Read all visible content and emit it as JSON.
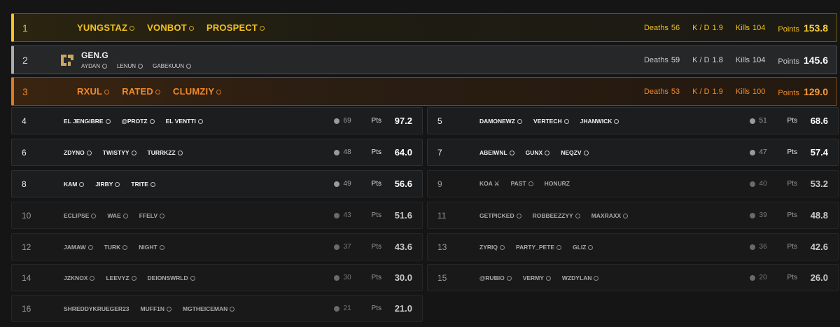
{
  "colors": {
    "gold": "#f5c518",
    "silver": "#a9abae",
    "bronze": "#e07a1a",
    "background": "#151515"
  },
  "top3": [
    {
      "rank": "1",
      "players": [
        "YUNGSTAZ",
        "VONBOT",
        "PROSPECT"
      ],
      "deaths_label": "Deaths",
      "deaths": "56",
      "kd_label": "K / D",
      "kd": "1.9",
      "kills_label": "Kills",
      "kills": "104",
      "points_label": "Points",
      "points": "153.8"
    },
    {
      "rank": "2",
      "team": "GEN.G",
      "logo": "geng-logo-icon",
      "players": [
        "AYDAN",
        "LENUN",
        "GABEKUUN"
      ],
      "deaths_label": "Deaths",
      "deaths": "59",
      "kd_label": "K / D",
      "kd": "1.8",
      "kills_label": "Kills",
      "kills": "104",
      "points_label": "Points",
      "points": "145.6"
    },
    {
      "rank": "3",
      "players": [
        "RXUL",
        "RATED",
        "CLUMZIY"
      ],
      "deaths_label": "Deaths",
      "deaths": "53",
      "kd_label": "K / D",
      "kd": "1.9",
      "kills_label": "Kills",
      "kills": "100",
      "points_label": "Points",
      "points": "129.0"
    }
  ],
  "pts_label": "Pts",
  "teams": [
    {
      "rank": "4",
      "players": [
        "EL JENGIBRE",
        "@PROTZ",
        "EL VENTTI"
      ],
      "kills": "69",
      "pts": "97.2"
    },
    {
      "rank": "5",
      "players": [
        "DAMONEWZ",
        "VERTECH",
        "JHANWICK"
      ],
      "kills": "51",
      "pts": "68.6"
    },
    {
      "rank": "6",
      "players": [
        "ZDYNO",
        "TWISTYY",
        "TURRKZZ"
      ],
      "kills": "48",
      "pts": "64.0"
    },
    {
      "rank": "7",
      "players": [
        "ABEIWNL",
        "GUNX",
        "NEQZV"
      ],
      "kills": "47",
      "pts": "57.4"
    },
    {
      "rank": "8",
      "players": [
        "KAM",
        "JIRBY",
        "TRITE"
      ],
      "kills": "49",
      "pts": "56.6"
    },
    {
      "rank": "9",
      "players": [
        "KOA ⚔",
        "PAST",
        "HONURZ"
      ],
      "kills": "40",
      "pts": "53.2"
    },
    {
      "rank": "10",
      "players": [
        "ECLIPSE",
        "WAE",
        "FFELV"
      ],
      "kills": "43",
      "pts": "51.6"
    },
    {
      "rank": "11",
      "players": [
        "GETPICKED",
        "ROBBEEZZYY",
        "MAXRAXX"
      ],
      "kills": "39",
      "pts": "48.8"
    },
    {
      "rank": "12",
      "players": [
        "JAMAW",
        "TURK",
        "NIGHT"
      ],
      "kills": "37",
      "pts": "43.6"
    },
    {
      "rank": "13",
      "players": [
        "ZYRIQ",
        "PARTY_PETE",
        "GLIZ"
      ],
      "kills": "36",
      "pts": "42.6"
    },
    {
      "rank": "14",
      "players": [
        "JZKNOX",
        "LEEVYZ",
        "DEIONSWRLD"
      ],
      "kills": "30",
      "pts": "30.0"
    },
    {
      "rank": "15",
      "players": [
        "@RUBIO",
        "VERMY",
        "WZDYLAN"
      ],
      "kills": "20",
      "pts": "26.0"
    },
    {
      "rank": "16",
      "players": [
        "SHREDDYKRUEGER23",
        "MUFF1N",
        "MGTHEICEMAN"
      ],
      "kills": "21",
      "pts": "21.0"
    }
  ]
}
